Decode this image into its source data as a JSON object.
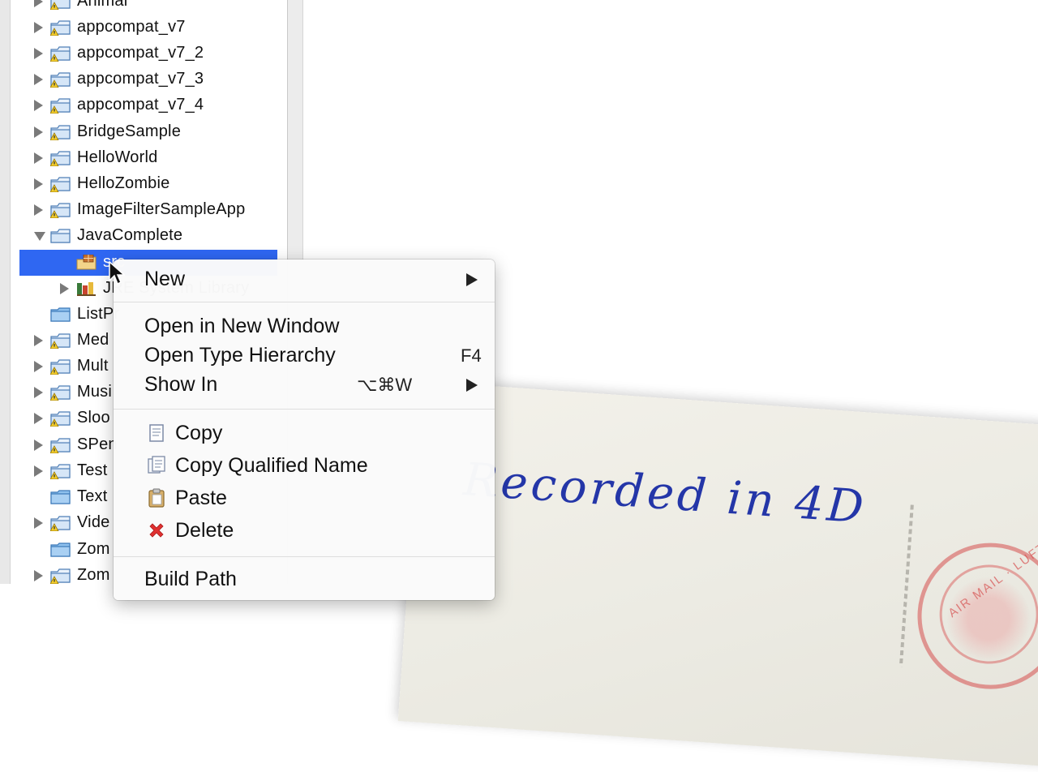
{
  "explorer": {
    "items": [
      {
        "label": "Animal",
        "state": "collapsed"
      },
      {
        "label": "appcompat_v7",
        "state": "collapsed"
      },
      {
        "label": "appcompat_v7_2",
        "state": "collapsed"
      },
      {
        "label": "appcompat_v7_3",
        "state": "collapsed"
      },
      {
        "label": "appcompat_v7_4",
        "state": "collapsed"
      },
      {
        "label": "BridgeSample",
        "state": "collapsed"
      },
      {
        "label": "HelloWorld",
        "state": "collapsed"
      },
      {
        "label": "HelloZombie",
        "state": "collapsed"
      },
      {
        "label": "ImageFilterSampleApp",
        "state": "collapsed"
      },
      {
        "label": "JavaComplete",
        "state": "expanded"
      },
      {
        "label": "src",
        "state": "selected"
      },
      {
        "label": "JRE System Library",
        "state": "collapsed"
      },
      {
        "label": "ListPr",
        "state": "none"
      },
      {
        "label": "Med",
        "state": "collapsed"
      },
      {
        "label": "Mult",
        "state": "collapsed"
      },
      {
        "label": "Musi",
        "state": "collapsed"
      },
      {
        "label": "Sloo",
        "state": "collapsed"
      },
      {
        "label": "SPen",
        "state": "collapsed"
      },
      {
        "label": "Test",
        "state": "collapsed"
      },
      {
        "label": "Text",
        "state": "none"
      },
      {
        "label": "Vide",
        "state": "collapsed"
      },
      {
        "label": "Zom",
        "state": "none"
      },
      {
        "label": "Zom",
        "state": "collapsed"
      }
    ]
  },
  "context_menu": {
    "new": {
      "label": "New"
    },
    "open_in_new_window": {
      "label": "Open in New Window"
    },
    "open_type_hierarchy": {
      "label": "Open Type Hierarchy",
      "shortcut": "F4"
    },
    "show_in": {
      "label": "Show In",
      "shortcut": "⌥⌘W"
    },
    "copy": {
      "label": "Copy"
    },
    "copy_qualified_name": {
      "label": "Copy Qualified Name"
    },
    "paste": {
      "label": "Paste"
    },
    "delete": {
      "label": "Delete"
    },
    "build_path": {
      "label": "Build Path"
    }
  },
  "postcard": {
    "text": "Recorded in 4D",
    "postmark": "AIR MAIL · LUFT"
  },
  "colors": {
    "selection": "#2f67f2",
    "postcard_ink": "#2436a8",
    "postmark": "#d64e4e",
    "delete_icon": "#e03030"
  },
  "icons": {
    "project_folder": "project-folder-icon",
    "source_folder": "source-package-folder-icon",
    "library": "library-icon",
    "copy": "copy-icon",
    "copy_qualified": "copy-qualified-name-icon",
    "paste": "paste-icon",
    "delete": "delete-icon"
  }
}
